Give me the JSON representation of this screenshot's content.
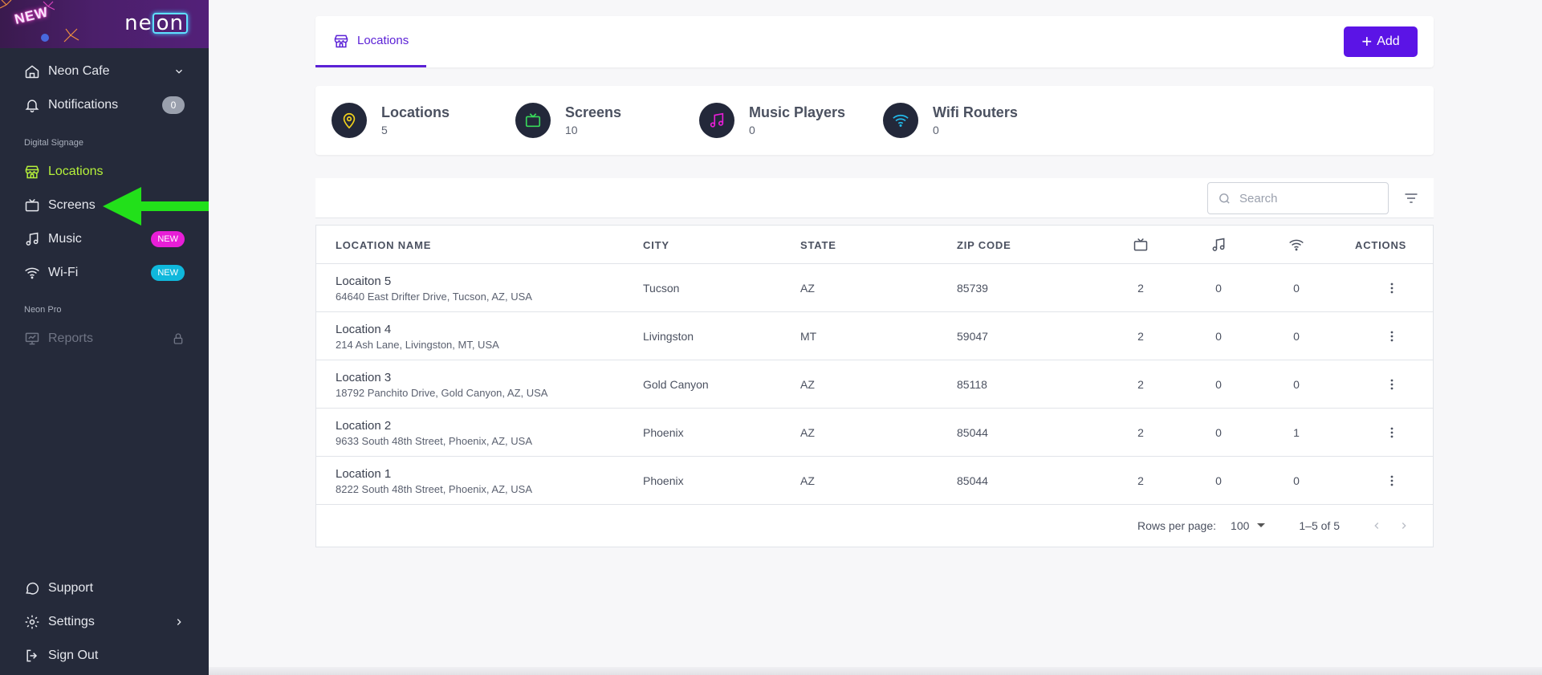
{
  "brand": {
    "badge": "NEW",
    "logo_text": "ne",
    "logo_box": "on"
  },
  "sidebar": {
    "workspace": "Neon Cafe",
    "notifications": {
      "label": "Notifications",
      "count": "0"
    },
    "section_digital": "Digital Signage",
    "items": [
      {
        "label": "Locations"
      },
      {
        "label": "Screens"
      },
      {
        "label": "Music",
        "badge": "NEW"
      },
      {
        "label": "Wi-Fi",
        "badge": "NEW"
      }
    ],
    "section_pro": "Neon Pro",
    "reports": "Reports",
    "support": "Support",
    "settings": "Settings",
    "sign_out": "Sign Out"
  },
  "tabbar": {
    "tab_label": "Locations",
    "add_label": "Add"
  },
  "stats": [
    {
      "label": "Locations",
      "value": "5",
      "icon": "map-pin-icon",
      "color": "#f2d21b"
    },
    {
      "label": "Screens",
      "value": "10",
      "icon": "tv-icon",
      "color": "#38d95a"
    },
    {
      "label": "Music Players",
      "value": "0",
      "icon": "music-note-icon",
      "color": "#e81ed7"
    },
    {
      "label": "Wifi Routers",
      "value": "0",
      "icon": "wifi-icon",
      "color": "#22b8e8"
    }
  ],
  "toolbar": {
    "search_placeholder": "Search"
  },
  "table": {
    "headers": {
      "name": "LOCATION NAME",
      "city": "CITY",
      "state": "STATE",
      "zip": "ZIP CODE",
      "actions": "ACTIONS"
    },
    "rows": [
      {
        "name": "Locaiton 5",
        "address": "64640 East Drifter Drive, Tucson, AZ, USA",
        "city": "Tucson",
        "state": "AZ",
        "zip": "85739",
        "screens": "2",
        "music": "0",
        "wifi": "0"
      },
      {
        "name": "Location 4",
        "address": "214 Ash Lane, Livingston, MT, USA",
        "city": "Livingston",
        "state": "MT",
        "zip": "59047",
        "screens": "2",
        "music": "0",
        "wifi": "0"
      },
      {
        "name": "Location 3",
        "address": "18792 Panchito Drive, Gold Canyon, AZ, USA",
        "city": "Gold Canyon",
        "state": "AZ",
        "zip": "85118",
        "screens": "2",
        "music": "0",
        "wifi": "0"
      },
      {
        "name": "Location 2",
        "address": "9633 South 48th Street, Phoenix, AZ, USA",
        "city": "Phoenix",
        "state": "AZ",
        "zip": "85044",
        "screens": "2",
        "music": "0",
        "wifi": "1"
      },
      {
        "name": "Location 1",
        "address": "8222 South 48th Street, Phoenix, AZ, USA",
        "city": "Phoenix",
        "state": "AZ",
        "zip": "85044",
        "screens": "2",
        "music": "0",
        "wifi": "0"
      }
    ]
  },
  "pager": {
    "rows_per_page_label": "Rows per page:",
    "rows_per_page": "100",
    "range": "1–5 of 5"
  },
  "colors": {
    "accent": "#5b14e6",
    "active_nav": "#b6f23a",
    "sidebar_bg": "#252a3a",
    "arrow": "#22e01a"
  }
}
